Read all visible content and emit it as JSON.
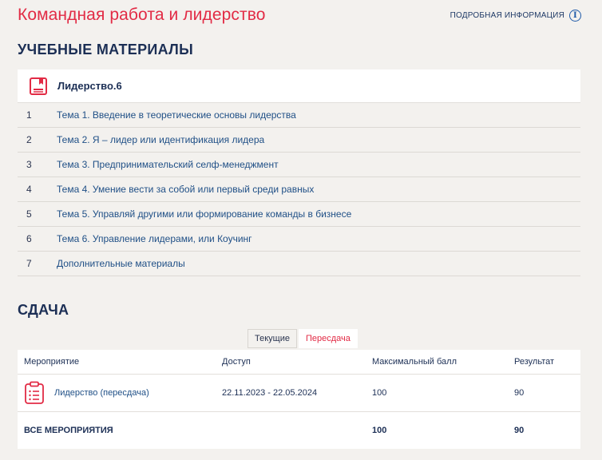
{
  "header": {
    "course_title": "Командная работа и лидерство",
    "info_link": "ПОДРОБНАЯ ИНФОРМАЦИЯ",
    "info_icon": "info-icon"
  },
  "materials": {
    "heading": "УЧЕБНЫЕ МАТЕРИАЛЫ",
    "course_name": "Лидерство.6",
    "course_icon": "book-icon",
    "topics": [
      {
        "num": "1",
        "title": "Тема 1. Введение в теоретические основы лидерства"
      },
      {
        "num": "2",
        "title": "Тема 2. Я – лидер или идентификация лидера"
      },
      {
        "num": "3",
        "title": "Тема 3. Предпринимательский селф-менеджмент"
      },
      {
        "num": "4",
        "title": "Тема 4. Умение вести за собой или первый среди равных"
      },
      {
        "num": "5",
        "title": "Тема 5. Управляй другими или формирование команды в бизнесе"
      },
      {
        "num": "6",
        "title": "Тема 6. Управление лидерами, или Коучинг"
      },
      {
        "num": "7",
        "title": "Дополнительные материалы"
      }
    ]
  },
  "submission": {
    "heading": "СДАЧА",
    "tabs": [
      {
        "label": "Текущие",
        "active": false
      },
      {
        "label": "Пересдача",
        "active": true
      }
    ],
    "columns": [
      "Мероприятие",
      "Доступ",
      "Максимальный балл",
      "Результат"
    ],
    "rows": [
      {
        "event": "Лидерство (пересдача)",
        "access": "22.11.2023 - 22.05.2024",
        "max_score": "100",
        "result": "90",
        "icon": "clipboard-icon"
      }
    ],
    "total": {
      "label": "ВСЕ МЕРОПРИЯТИЯ",
      "max_score": "100",
      "result": "90"
    }
  },
  "colors": {
    "accent": "#e22b45",
    "link": "#1f4f86",
    "heading": "#1c2f55",
    "background": "#f3f1ee"
  }
}
